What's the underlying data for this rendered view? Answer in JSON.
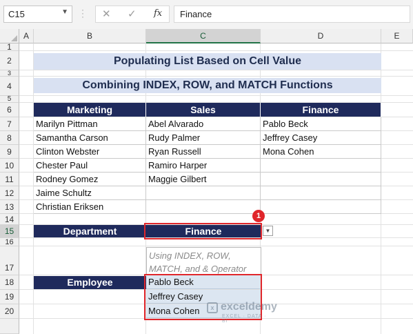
{
  "formula_bar": {
    "name_box": "C15",
    "cancel_glyph": "✕",
    "enter_glyph": "✓",
    "fx_label": "fx",
    "content": "Finance"
  },
  "columns": [
    "A",
    "B",
    "C",
    "D",
    "E"
  ],
  "selected_column": "C",
  "rows": [
    "1",
    "2",
    "3",
    "4",
    "5",
    "6",
    "7",
    "8",
    "9",
    "10",
    "11",
    "12",
    "13",
    "14",
    "15",
    "16",
    "17",
    "18",
    "19",
    "20"
  ],
  "selected_row": "15",
  "titles": {
    "main": "Populating List Based on Cell Value",
    "sub": "Combining INDEX, ROW, and MATCH Functions"
  },
  "table": {
    "headers": [
      "Marketing",
      "Sales",
      "Finance"
    ],
    "rows": [
      [
        "Marilyn Pittman",
        "Abel Alvarado",
        "Pablo Beck"
      ],
      [
        "Samantha Carson",
        "Rudy Palmer",
        "Jeffrey Casey"
      ],
      [
        "Clinton Webster",
        "Ryan Russell",
        "Mona Cohen"
      ],
      [
        "Chester Paul",
        "Ramiro Harper",
        ""
      ],
      [
        "Rodney Gomez",
        "Maggie Gilbert",
        ""
      ],
      [
        "Jaime Schultz",
        "",
        ""
      ],
      [
        "Christian Eriksen",
        "",
        ""
      ]
    ]
  },
  "department": {
    "label": "Department",
    "value": "Finance",
    "badge": "1",
    "dropdown_glyph": "▼"
  },
  "note": "Using INDEX, ROW, MATCH, and & Operator",
  "employee": {
    "label": "Employee",
    "results": [
      "Pablo Beck",
      "Jeffrey Casey",
      "Mona Cohen"
    ]
  },
  "watermark": {
    "name": "exceldemy",
    "tagline": "EXCEL · DATA · BI"
  },
  "colors": {
    "header_navy": "#1f2a5c",
    "title_band": "#d9e1f2",
    "highlight_red": "#e0262b",
    "result_fill": "#dce6f1"
  }
}
